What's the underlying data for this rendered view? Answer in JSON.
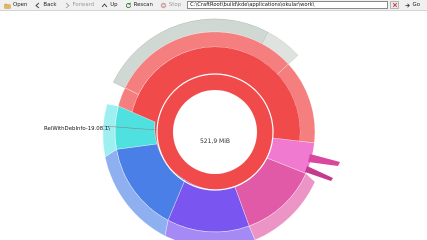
{
  "toolbar": {
    "open": "Open",
    "back": "Back",
    "forward": "Forward",
    "up": "Up",
    "rescan": "Rescan",
    "stop": "Stop",
    "path_value": "C:\\CraftRoot\\build\\kde\\applications\\okular\\work\\",
    "go": "Go"
  },
  "map": {
    "center_size": "521,9 MiB",
    "hover_label": "RelWithDebInfo-19.08.1\\"
  },
  "colors": {
    "root_red": "#f04a4a",
    "ring_red": "#f57f7f",
    "cyan": "#4fe0e0",
    "blue": "#4a7fe8",
    "violet": "#7a55f0",
    "magenta": "#e05aa8",
    "pink": "#f07ad0",
    "outer_grey": "#cfd8d2"
  }
}
